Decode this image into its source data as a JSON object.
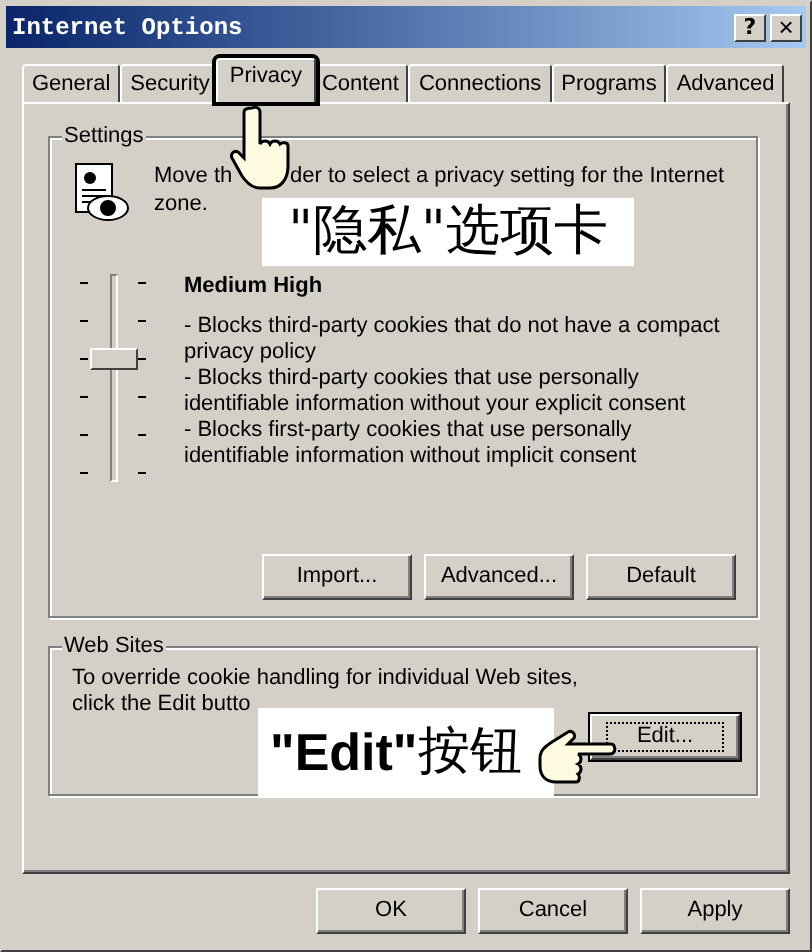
{
  "window": {
    "title": "Internet Options",
    "controls": [
      {
        "kind": "help",
        "label": "?"
      },
      {
        "kind": "close",
        "label": "×"
      }
    ]
  },
  "tabs": [
    {
      "label": "General",
      "selected": false
    },
    {
      "label": "Security",
      "selected": false
    },
    {
      "label": "Privacy",
      "selected": true
    },
    {
      "label": "Content",
      "selected": false
    },
    {
      "label": "Connections",
      "selected": false
    },
    {
      "label": "Programs",
      "selected": false
    },
    {
      "label": "Advanced",
      "selected": false
    }
  ],
  "settings": {
    "legend": "Settings",
    "intro_before": "Move th",
    "intro_after": "der to select a privacy setting for the Internet",
    "intro_line2": "zone.",
    "slider": {
      "level": 0.6
    },
    "level_name": "Medium High",
    "description": [
      "- Blocks third-party cookies that do not have a compact privacy policy",
      "- Blocks third-party cookies that use personally identifiable information without your explicit consent",
      "- Blocks first-party cookies that use personally identifiable information without implicit consent"
    ],
    "buttons": [
      "Import...",
      "Advanced...",
      "Default"
    ]
  },
  "web_sites": {
    "legend": "Web Sites",
    "line1": "To override cookie handling for individual Web sites,",
    "line2": "click the Edit butto",
    "button": {
      "label": "Edit...",
      "focused": true
    }
  },
  "dialog_buttons": [
    "OK",
    "Cancel",
    "Apply"
  ],
  "annotations": [
    {
      "kind": "tab",
      "text": "\"隐私\"选项卡"
    },
    {
      "kind": "button",
      "text": "**\"Edit\"**按钮"
    }
  ]
}
